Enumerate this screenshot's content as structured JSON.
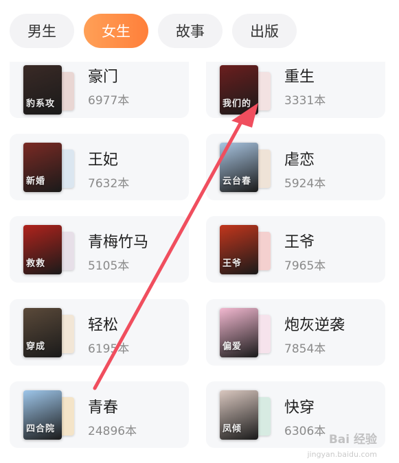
{
  "tabs": [
    {
      "label": "男生",
      "active": false
    },
    {
      "label": "女生",
      "active": true
    },
    {
      "label": "故事",
      "active": false
    },
    {
      "label": "出版",
      "active": false
    }
  ],
  "categories": [
    {
      "name": "豪门",
      "count": "6977本"
    },
    {
      "name": "重生",
      "count": "3331本"
    },
    {
      "name": "王妃",
      "count": "7632本"
    },
    {
      "name": "虐恋",
      "count": "5924本"
    },
    {
      "name": "青梅竹马",
      "count": "5105本"
    },
    {
      "name": "王爷",
      "count": "7965本"
    },
    {
      "name": "轻松",
      "count": "6195本"
    },
    {
      "name": "炮灰逆袭",
      "count": "7854本"
    },
    {
      "name": "青春",
      "count": "24896本"
    },
    {
      "name": "快穿",
      "count": "6306本"
    }
  ],
  "covers": [
    {
      "front": "#3a2a26",
      "back": "#e9d6d3",
      "text": "豹系攻"
    },
    {
      "front": "#6b1e1e",
      "back": "#f3e2e2",
      "text": "我们的"
    },
    {
      "front": "#7a2a24",
      "back": "#dbe6f0",
      "text": "新婚"
    },
    {
      "front": "#a8c4e0",
      "back": "#efe3d7",
      "text": "云台春"
    },
    {
      "front": "#b0231c",
      "back": "#e7dfe8",
      "text": "救救"
    },
    {
      "front": "#c2361d",
      "back": "#f4d0cf",
      "text": "王爷"
    },
    {
      "front": "#5b4a3a",
      "back": "#f2e6d6",
      "text": "穿成"
    },
    {
      "front": "#f2b8d0",
      "back": "#f6e3ec",
      "text": "偏爱"
    },
    {
      "front": "#9ec6ea",
      "back": "#f4e4c8",
      "text": "四合院"
    },
    {
      "front": "#d9c7bf",
      "back": "#d7ebe2",
      "text": "凤倾"
    }
  ],
  "watermark": {
    "text": "Bai 经验",
    "sub": "jingyan.baidu.com"
  },
  "annotation_color": "#f04e5e"
}
